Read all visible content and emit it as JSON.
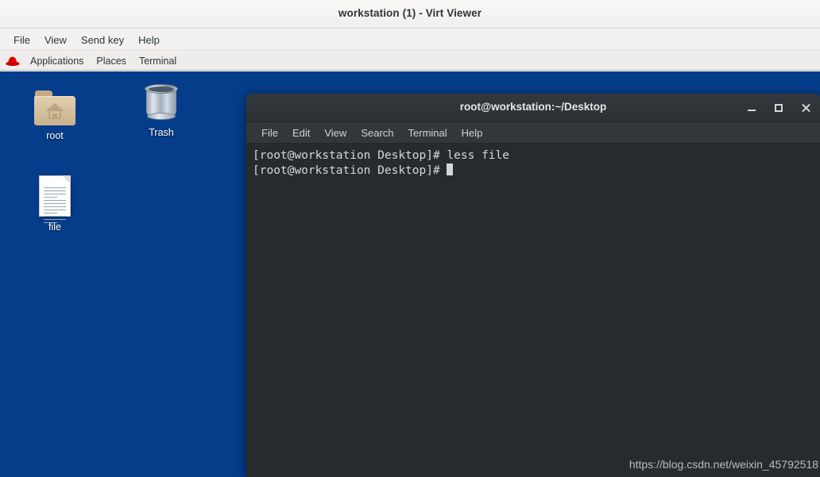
{
  "viewer": {
    "title": "workstation (1) - Virt Viewer",
    "menu": [
      {
        "label": "File"
      },
      {
        "label": "View"
      },
      {
        "label": "Send key"
      },
      {
        "label": "Help"
      }
    ]
  },
  "panel": {
    "logo_icon": "red-hat-icon",
    "items": [
      {
        "label": "Applications"
      },
      {
        "label": "Places"
      },
      {
        "label": "Terminal"
      }
    ]
  },
  "desktop": {
    "background_color": "#063d8b",
    "icons": [
      {
        "label": "root",
        "icon": "home-folder-icon"
      },
      {
        "label": "Trash",
        "icon": "trash-can-icon"
      },
      {
        "label": "file",
        "icon": "text-document-icon"
      }
    ]
  },
  "terminal": {
    "title": "root@workstation:~/Desktop",
    "background_color": "#272b2e",
    "foreground_color": "#d6d6d6",
    "menu": [
      {
        "label": "File"
      },
      {
        "label": "Edit"
      },
      {
        "label": "View"
      },
      {
        "label": "Search"
      },
      {
        "label": "Terminal"
      },
      {
        "label": "Help"
      }
    ],
    "controls": {
      "minimize": "minimize-icon",
      "maximize": "maximize-icon",
      "close": "close-icon"
    },
    "lines": [
      "[root@workstation Desktop]# less file",
      "[root@workstation Desktop]# "
    ],
    "prompt": "[root@workstation Desktop]# ",
    "command": "less file"
  },
  "watermark": {
    "text": "https://blog.csdn.net/weixin_45792518"
  }
}
